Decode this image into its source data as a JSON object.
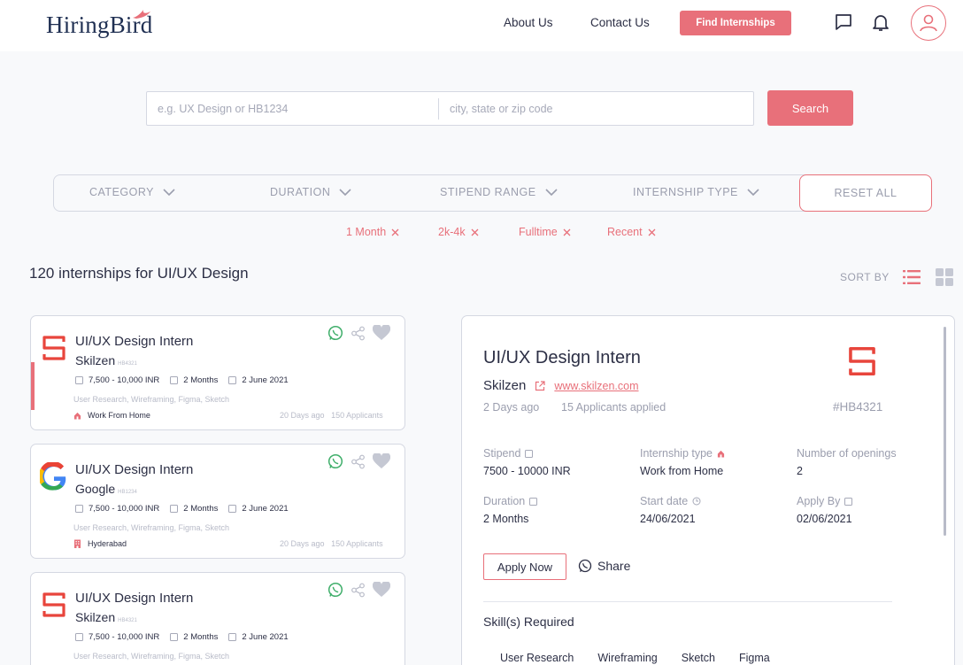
{
  "brand": {
    "name": "HiringBird",
    "accent": "#e8707a",
    "navy": "#1f2f52"
  },
  "nav": {
    "about": "About Us",
    "contact": "Contact Us",
    "cta": "Find Internships"
  },
  "search": {
    "query_placeholder": "e.g. UX Design or HB1234",
    "location_placeholder": "city, state or zip code",
    "button": "Search"
  },
  "filters": {
    "category": "CATEGORY",
    "duration": "DURATION",
    "stipend": "STIPEND RANGE",
    "type": "INTERNSHIP TYPE",
    "reset": "RESET ALL"
  },
  "filter_chips": [
    "1 Month",
    "2k-4k",
    "Fulltime",
    "Recent"
  ],
  "results": {
    "title": "120 internships for UI/UX Design",
    "sort_label": "SORT BY"
  },
  "listings": [
    {
      "title": "UI/UX Design Intern",
      "company": "Skilzen",
      "code": "HB4321",
      "logo": "skilzen-logo",
      "stipend": "7,500 - 10,000 INR",
      "duration": "2 Months",
      "start": "2 June 2021",
      "skills": "User Research, Wireframing, Figma, Sketch",
      "location": "Work From Home",
      "location_icon": "home-icon",
      "posted": "20 Days ago",
      "applicants": "150 Applicants"
    },
    {
      "title": "UI/UX Design Intern",
      "company": "Google",
      "code": "HB1234",
      "logo": "google-logo",
      "stipend": "7,500 - 10,000 INR",
      "duration": "2 Months",
      "start": "2 June 2021",
      "skills": "User Research, Wireframing, Figma, Sketch",
      "location": "Hyderabad",
      "location_icon": "building-icon",
      "posted": "20 Days ago",
      "applicants": "150 Applicants"
    },
    {
      "title": "UI/UX Design Intern",
      "company": "Skilzen",
      "code": "HB4321",
      "logo": "skilzen-logo",
      "stipend": "7,500 - 10,000 INR",
      "duration": "2 Months",
      "start": "2 June 2021",
      "skills": "User Research, Wireframing, Figma, Sketch",
      "location": "",
      "location_icon": "",
      "posted": "",
      "applicants": ""
    }
  ],
  "detail": {
    "title": "UI/UX Design Intern",
    "company": "Skilzen",
    "website": "www.skilzen.com",
    "posted": "2 Days ago",
    "applied": "15 Applicants applied",
    "id": "#HB4321",
    "stipend_label": "Stipend",
    "stipend": "7500 - 10000 INR",
    "type_label": "Internship type",
    "type": "Work from Home",
    "openings_label": "Number of openings",
    "openings": "2",
    "duration_label": "Duration",
    "duration": "2 Months",
    "start_label": "Start date",
    "start": "24/06/2021",
    "apply_by_label": "Apply By",
    "apply_by": "02/06/2021",
    "apply_button": "Apply Now",
    "share_button": "Share",
    "skills_title": "Skill(s) Required",
    "skills": [
      "User Research",
      "Wireframing",
      "Sketch",
      "Figma"
    ]
  }
}
